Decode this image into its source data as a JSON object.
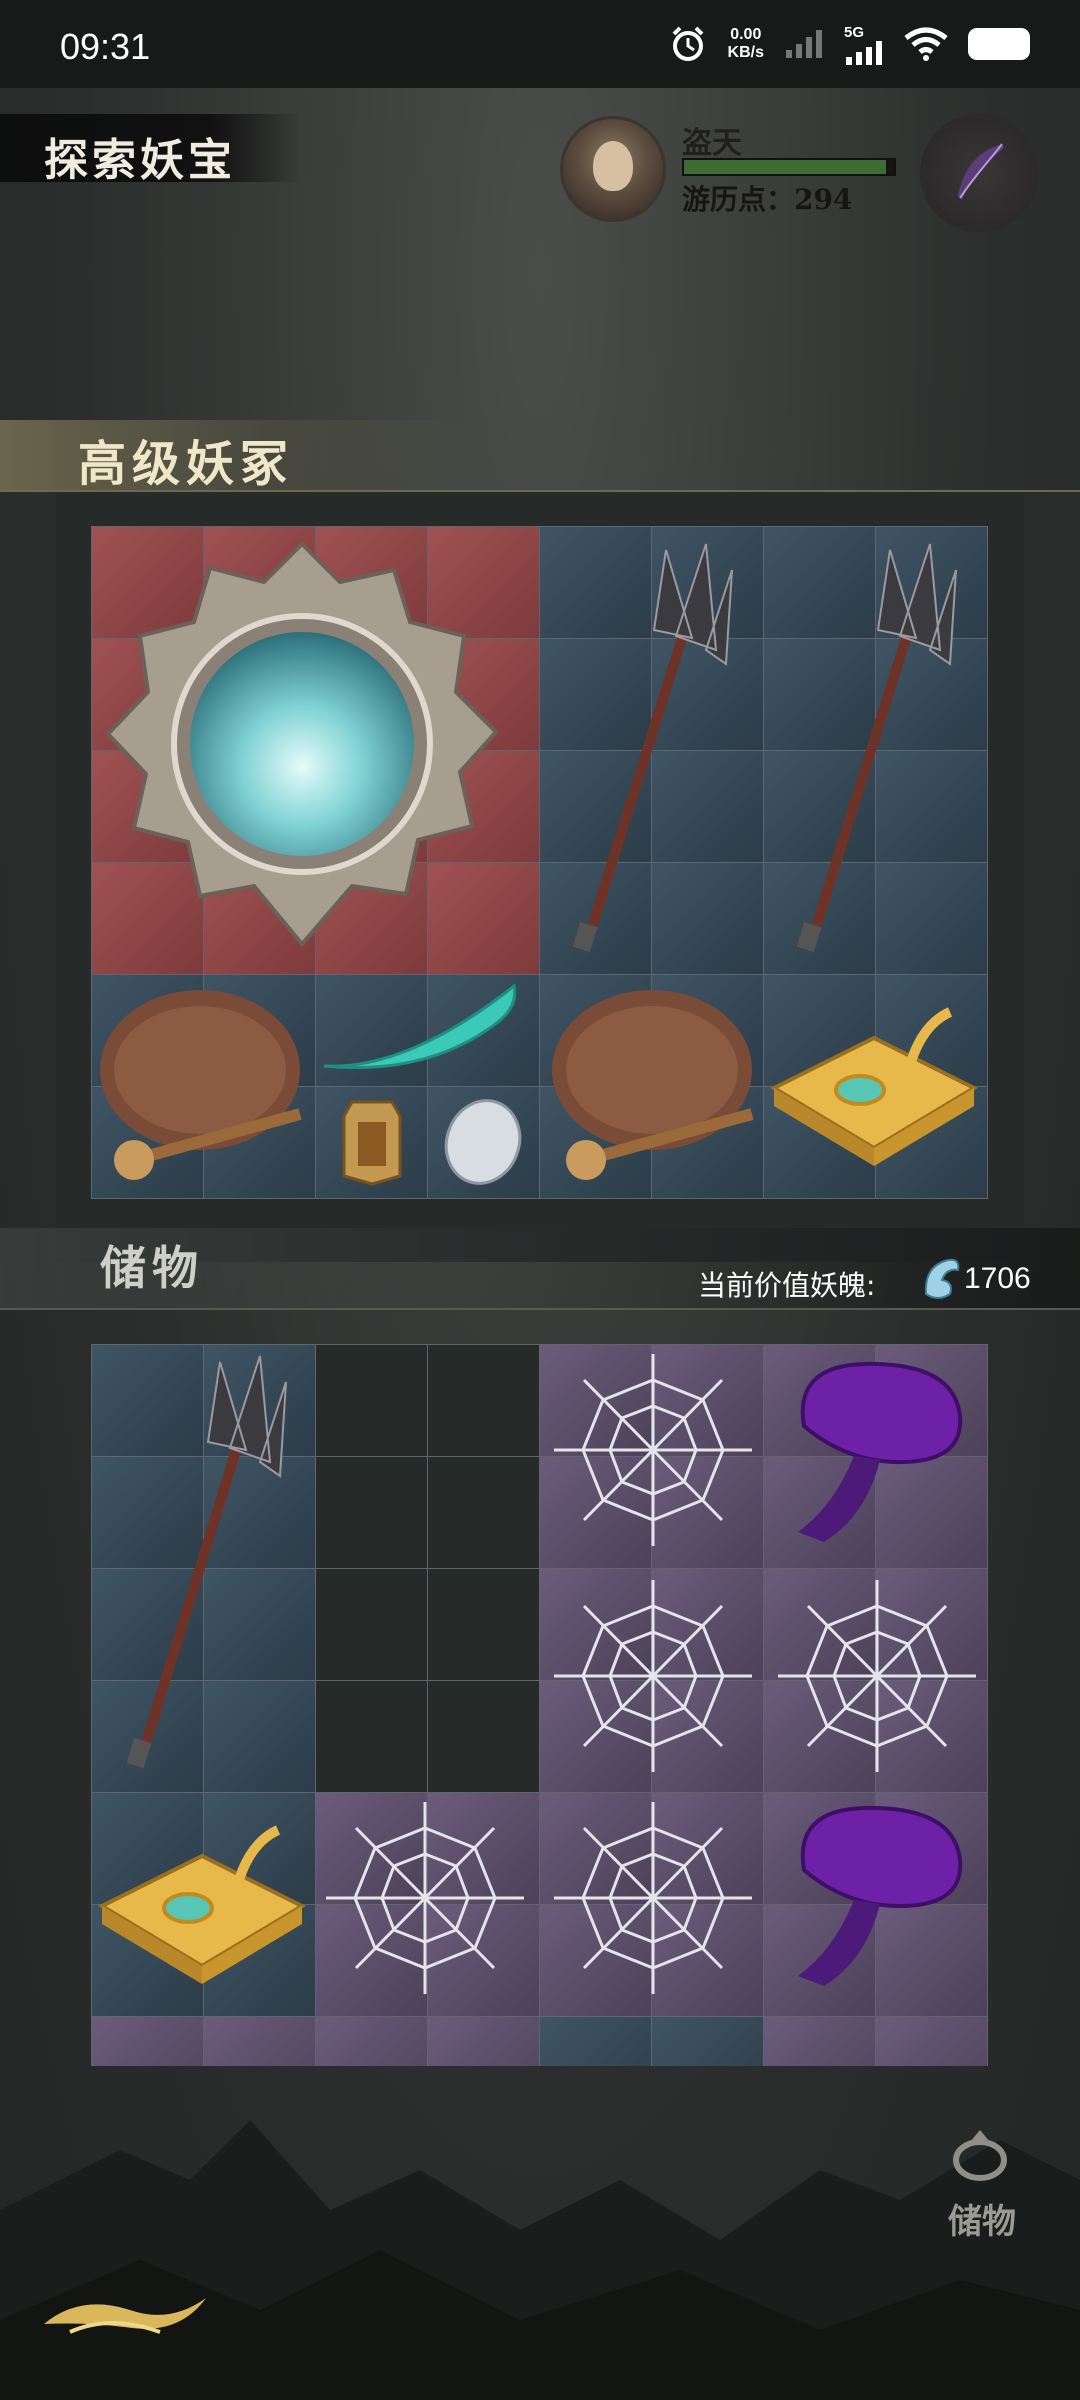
{
  "status_bar": {
    "time": "09:31",
    "net_speed": "0.00",
    "net_unit": "KB/s",
    "network": "5G"
  },
  "header": {
    "title": "探索妖宝",
    "player_name": "盗天",
    "exp_label": "游历点：294"
  },
  "top_section": {
    "title": "高级妖冢"
  },
  "storage_section": {
    "title": "储物",
    "value_label": "当前价值妖魄:",
    "value": "1706"
  },
  "bottom_button": {
    "label": "储物"
  },
  "top_grid": {
    "cells": [
      "red",
      "red",
      "red",
      "red",
      "blue",
      "blue",
      "blue",
      "blue",
      "red",
      "red",
      "red",
      "red",
      "blue",
      "blue",
      "blue",
      "blue",
      "red",
      "red",
      "red",
      "red",
      "blue",
      "blue",
      "blue",
      "blue",
      "red",
      "red",
      "red",
      "red",
      "blue",
      "blue",
      "blue",
      "blue",
      "blue",
      "blue",
      "blue",
      "blue",
      "blue",
      "blue",
      "blue",
      "blue",
      "blue",
      "blue",
      "blue",
      "blue",
      "blue",
      "blue",
      "blue",
      "blue"
    ],
    "items": [
      "mirror",
      "trident",
      "trident",
      "bell",
      "jade-horn",
      "bell",
      "golden-tray",
      "token",
      "fur-ball"
    ]
  },
  "bottom_grid": {
    "cells": [
      "blue",
      "blue",
      "empty",
      "empty",
      "purple",
      "purple",
      "purple",
      "purple",
      "blue",
      "blue",
      "empty",
      "empty",
      "purple",
      "purple",
      "purple",
      "purple",
      "blue",
      "blue",
      "empty",
      "empty",
      "purple",
      "purple",
      "purple",
      "purple",
      "blue",
      "blue",
      "empty",
      "empty",
      "purple",
      "purple",
      "purple",
      "purple",
      "blue",
      "blue",
      "purple",
      "purple",
      "purple",
      "purple",
      "purple",
      "purple",
      "blue",
      "blue",
      "purple",
      "purple",
      "purple",
      "purple",
      "purple",
      "purple",
      "purple",
      "purple",
      "purple",
      "purple",
      "blue",
      "blue",
      "purple",
      "purple"
    ],
    "items": [
      "trident",
      "spider-web",
      "mushroom",
      "spider-web",
      "spider-web",
      "golden-tray",
      "spider-web",
      "spider-web",
      "mushroom"
    ]
  }
}
